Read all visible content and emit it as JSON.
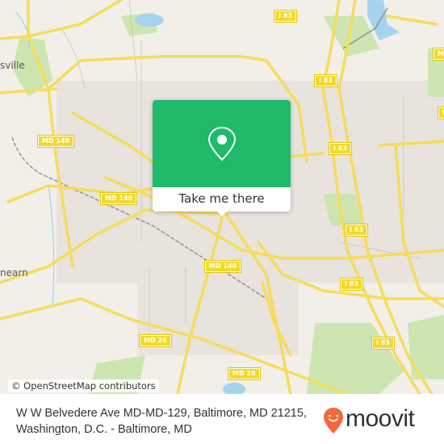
{
  "map": {
    "place_labels": [
      "sville",
      "nearn"
    ],
    "route_shields": [
      "I 83",
      "I 83",
      "I 83",
      "I 83",
      "I 83",
      "I 83",
      "MD 140",
      "MD 140",
      "MD 140",
      "MD 26",
      "MD 26",
      "M",
      "I"
    ],
    "attribution": "© OpenStreetMap contributors",
    "colors": {
      "background": "#f2efe9",
      "road": "#f6dc5a",
      "park": "#cde6b1",
      "water": "#a5d4ee",
      "shield": "#f3d92b"
    }
  },
  "popup": {
    "icon": "map-pin-icon",
    "button_label": "Take me there",
    "color": "#1fba6a"
  },
  "footer": {
    "address": "W W Belvedere Ave MD-MD-129, Baltimore, MD 21215, Washington, D.C. - Baltimore, MD",
    "logo_text": "moovit",
    "logo_color": "#f06a3a"
  }
}
